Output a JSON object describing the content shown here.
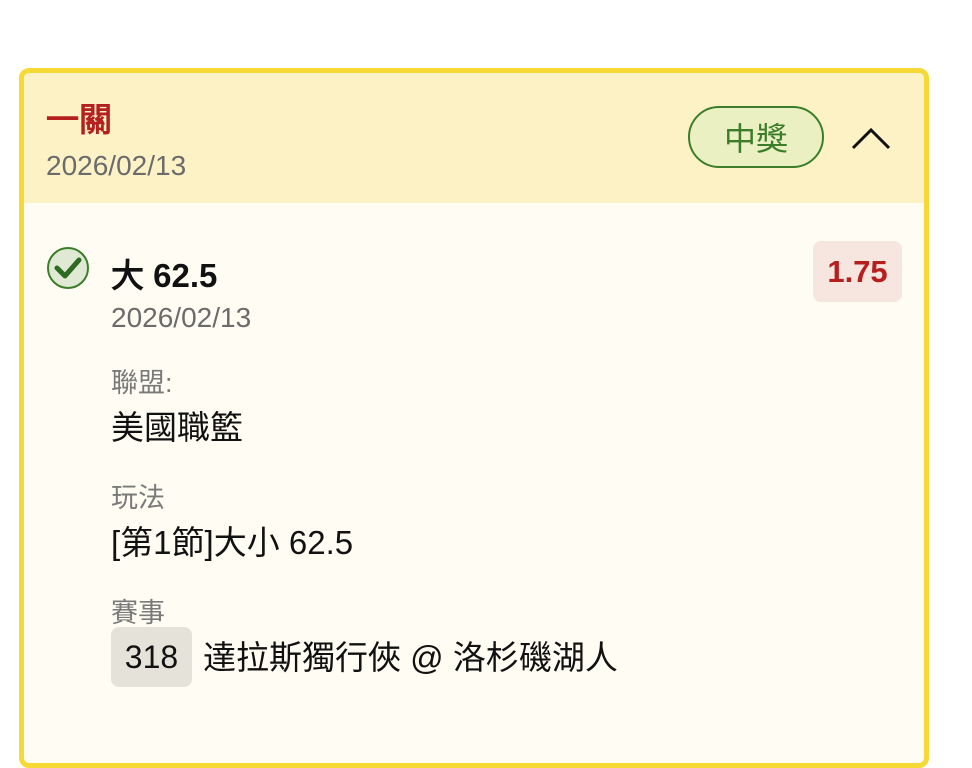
{
  "bet": {
    "type_label": "一關",
    "date": "2026/02/13",
    "status": "中獎"
  },
  "selection": {
    "title": "大 62.5",
    "date": "2026/02/13",
    "odds": "1.75",
    "league_label": "聯盟:",
    "league": "美國職籃",
    "play_label": "玩法",
    "play": "[第1節]大小 62.5",
    "event_label": "賽事",
    "game_no": "318",
    "event": "達拉斯獨行俠 @ 洛杉磯湖人"
  },
  "icons": {
    "check": "check-circle-icon",
    "collapse": "chevron-up-icon"
  },
  "colors": {
    "card_border": "#f6d936",
    "header_bg": "#fdf2c6",
    "win_green": "#3c7d2a",
    "odds_red": "#b5201e"
  }
}
